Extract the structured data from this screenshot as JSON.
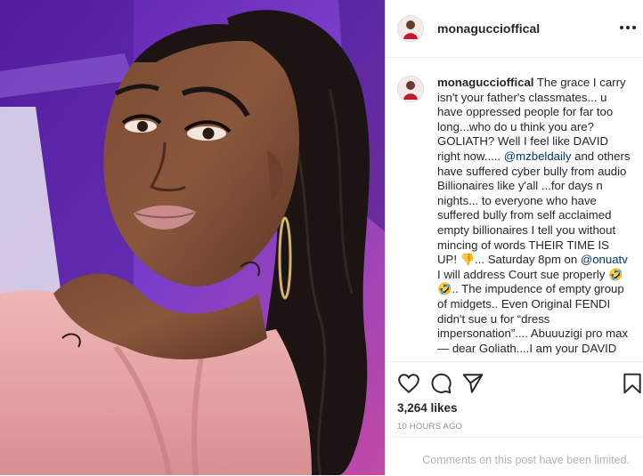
{
  "post": {
    "username": "monaguccioffical",
    "photo_alt": "selfie photo",
    "caption_user": "monaguccioffical",
    "caption_parts": [
      " The grace I carry isn't your father's classmates... u have oppressed people for far too long...who do u think you are? GOLIATH? Well I feel like DAVID right now..... ",
      "@mzbeldaily",
      " and others have suffered cyber bully from audio Billionaires like y'all ...for days n nights... to everyone who have suffered bully from self acclaimed empty billionaires I tell you without mincing of words THEIR TIME IS UP! 👎... Saturday 8pm on ",
      "@onuatv",
      " I will address Court sue properly 🤣🤣.. The impudence of empty group of midgets.. Even Original FENDI didn't sue u for “dress impersonation”.... Abuuuzigi pro max— dear Goliath....I am your DAVID"
    ],
    "likes": "3,264 likes",
    "timestamp": "10 HOURS AGO",
    "comments_notice": "Comments on this post have been limited."
  },
  "icons": {
    "more": "more-options-icon",
    "like": "heart-icon",
    "comment": "comment-icon",
    "share": "share-icon",
    "save": "bookmark-icon"
  },
  "colors": {
    "text": "#262626",
    "mention": "#00376b",
    "muted": "#8e8e8e",
    "border": "#dbdbdb",
    "photo_bg": "#6a2fb4",
    "blouse": "#e9a7a9",
    "avatar_accent": "#c0192f"
  }
}
